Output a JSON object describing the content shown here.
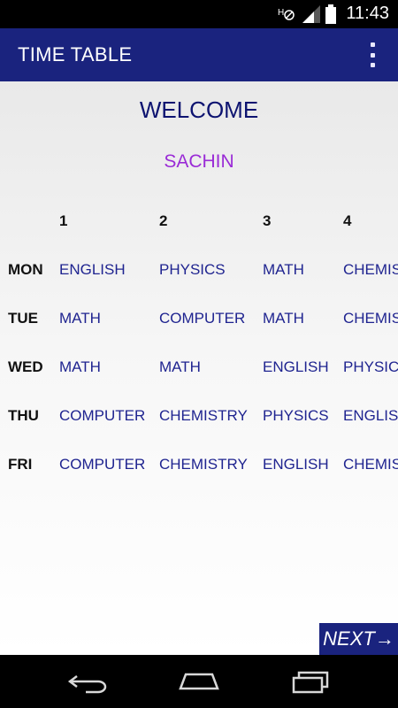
{
  "status_bar": {
    "time": "11:43"
  },
  "app_bar": {
    "title": "TIME TABLE",
    "overflow_icon": "overflow-menu-icon"
  },
  "welcome": {
    "heading": "WELCOME",
    "user_name": "SACHIN"
  },
  "timetable": {
    "periods": [
      "1",
      "2",
      "3",
      "4"
    ],
    "rows": [
      {
        "day": "MON",
        "subjects": [
          "ENGLISH",
          "PHYSICS",
          "MATH",
          "CHEMISTRY"
        ]
      },
      {
        "day": "TUE",
        "subjects": [
          "MATH",
          "COMPUTER",
          "MATH",
          "CHEMISTRY"
        ]
      },
      {
        "day": "WED",
        "subjects": [
          "MATH",
          "MATH",
          "ENGLISH",
          "PHYSICS"
        ]
      },
      {
        "day": "THU",
        "subjects": [
          "COMPUTER",
          "CHEMISTRY",
          "PHYSICS",
          "ENGLISH"
        ]
      },
      {
        "day": "FRI",
        "subjects": [
          "COMPUTER",
          "CHEMISTRY",
          "ENGLISH",
          "CHEMISTRY"
        ]
      }
    ]
  },
  "next_button": {
    "label": "NEXT→"
  },
  "colors": {
    "app_bar": "#1a237e",
    "heading": "#0d1370",
    "user_name": "#9a2bd6",
    "subject_text": "#1f2490"
  }
}
